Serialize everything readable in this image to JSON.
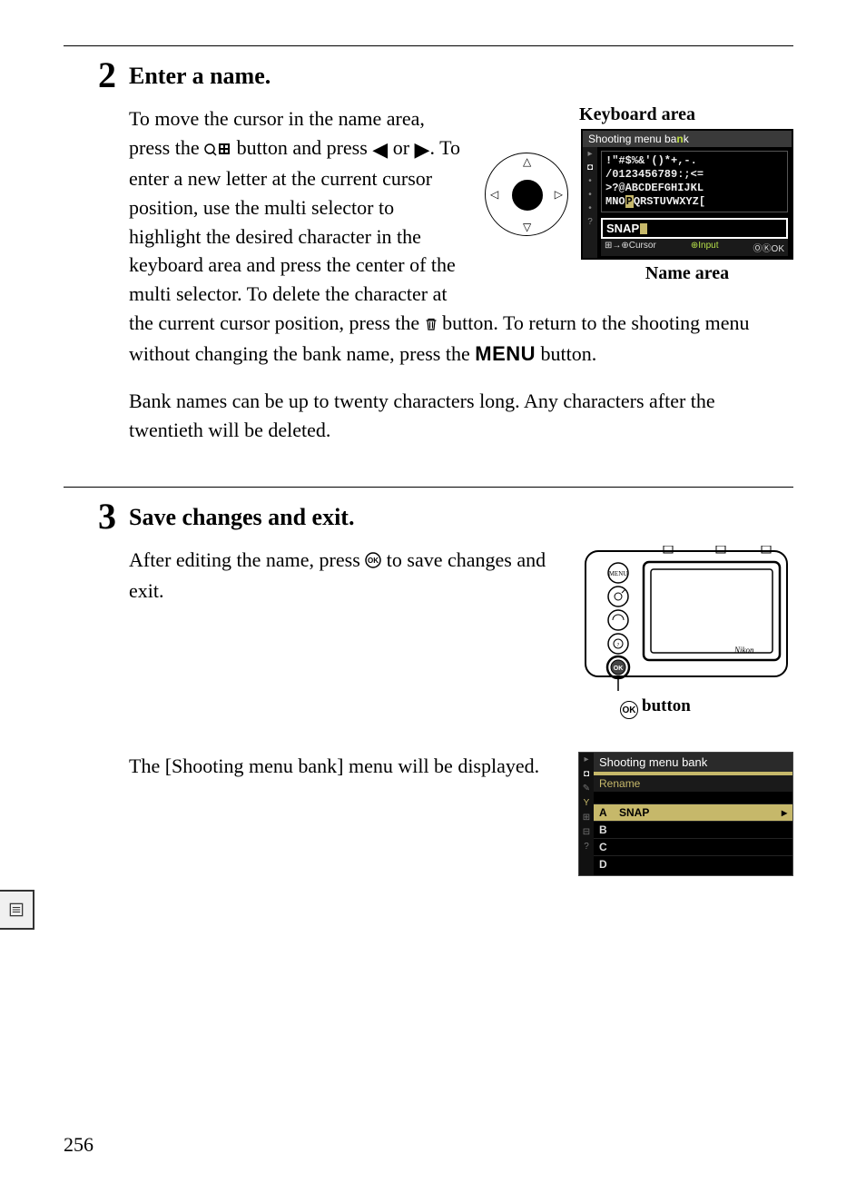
{
  "page_number": "256",
  "step2": {
    "num": "2",
    "title": "Enter a name.",
    "para1_a": "To move the cursor in the name area, press the ",
    "para1_b": " button and press ",
    "para1_c": " or ",
    "para1_d": ".  To enter a new letter at the current cursor position, use the multi selector to highlight the desired character in the",
    "para1_e": "keyboard area and press the center of the multi selector.  To delete the character at the current cursor position, press the ",
    "para1_f": " button.  To return to the shooting menu without changing the bank name, press the ",
    "menu_word": "MENU",
    "para1_g": " button.",
    "para2": "Bank names can be up to twenty characters long.  Any characters after the twentieth will be deleted.",
    "fig": {
      "keyboard_label": "Keyboard area",
      "name_label": "Name area",
      "screen_title_a": "Shooting menu ba",
      "screen_title_hl": "n",
      "screen_title_b": "k",
      "char_row1": " !\"#$%&'()*+,-.",
      "char_row2": "/0123456789:;<=",
      "char_row3": ">?@ABCDEFGHIJKL",
      "char_row4_a": "MNO",
      "char_row4_sel": "P",
      "char_row4_b": "QRSTUVWXYZ[",
      "name_value": "SNAP",
      "footer_cursor": "Cursor",
      "footer_input": "Input",
      "footer_ok": "OK"
    }
  },
  "step3": {
    "num": "3",
    "title": "Save changes and exit.",
    "para1_a": "After editing the name, press ",
    "para1_b": " to save changes and exit.",
    "ok_button_label": "button",
    "para2": "The [Shooting menu bank] menu will be displayed.",
    "bank": {
      "title": "Shooting menu bank",
      "subtitle": "Rename",
      "rows": [
        {
          "letter": "A",
          "name": "SNAP",
          "selected": true
        },
        {
          "letter": "B",
          "name": "",
          "selected": false
        },
        {
          "letter": "C",
          "name": "",
          "selected": false
        },
        {
          "letter": "D",
          "name": "",
          "selected": false
        }
      ]
    }
  }
}
